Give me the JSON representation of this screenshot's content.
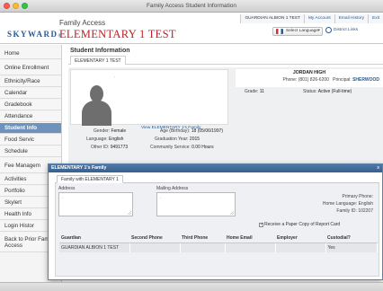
{
  "window": {
    "title": "Family Access Student Information"
  },
  "header": {
    "logo": "SKYWARD",
    "logo_mark": "®",
    "app_name": "Family Access",
    "student_name": "ELEMENTARY 1 TEST",
    "user": "GUARDIAN ALBION 1 TEST",
    "links": {
      "my_account": "My Account",
      "email_history": "Email History",
      "exit": "Exit"
    },
    "language": "Select Language",
    "district_links": "District Links"
  },
  "sidebar": {
    "items": [
      {
        "label": "Home"
      },
      {
        "label": "Online Enrollment"
      },
      {
        "label": "Ethnicity/Race"
      },
      {
        "label": "Calendar"
      },
      {
        "label": "Gradebook"
      },
      {
        "label": "Attendance"
      },
      {
        "label": "Student Info"
      },
      {
        "label": "Food Servic"
      },
      {
        "label": "Schedule"
      },
      {
        "label": "Fee Managem"
      },
      {
        "label": "Activities"
      },
      {
        "label": "Portfolio"
      },
      {
        "label": "Skylert"
      },
      {
        "label": "Health Info"
      },
      {
        "label": "Login Histor"
      },
      {
        "label": "Back to Prior Family Access"
      }
    ],
    "active_index": 6
  },
  "student_info": {
    "title": "Student Information",
    "tab": "ELEMENTARY 1 TEST",
    "photo_placeholder": ".",
    "family_link": "View ELEMENTARY 1's Family",
    "gender_label": "Gender:",
    "gender": "Female",
    "language_label": "Language:",
    "language": "English",
    "other_id_label": "Other ID:",
    "other_id": "9491773",
    "age_label": "Age (Birthday):",
    "age": "18 (05/06/1997)",
    "graduation_label": "Graduation Year:",
    "graduation": "2015",
    "service_label": "Community Service:",
    "service": "0.00 Hours",
    "school": "JORDAN HIGH",
    "phone_label": "Phone:",
    "phone": "(801) 826-6200",
    "principal_label": "Principal:",
    "principal": "SHERWOOD",
    "grade_label": "Grade:",
    "grade": "11",
    "status_label": "Status:",
    "status": "Active (Full-time)"
  },
  "family_dialog": {
    "title": "ELEMENTARY 1's Family",
    "close": "x",
    "tab": "Family with ELEMENTARY 1",
    "address_label": "Address",
    "mailing_label": "Mailing Address",
    "placeholder": ".",
    "primary_phone_label": "Primary Phone:",
    "home_language_label": "Home Language:",
    "home_language": "English",
    "family_id_label": "Family ID:",
    "family_id": "102207",
    "report_card": "Receive a Paper Copy of Report Card",
    "columns": [
      "Guardian",
      "Second Phone",
      "Third Phone",
      "Home Email",
      "Employer",
      "Custodial?"
    ],
    "rows": [
      [
        "GUARDIAN ALBION 1 TEST",
        "",
        "",
        "",
        "",
        "Yes"
      ]
    ]
  }
}
